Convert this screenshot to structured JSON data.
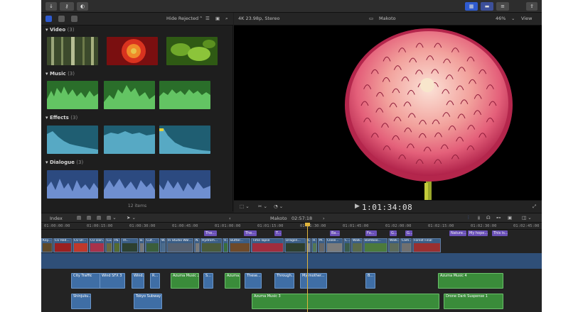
{
  "colors": {
    "accent": "#2f5bd0",
    "clip_video": "#3b5e86",
    "clip_audio_green": "#3a8c3a",
    "clip_title": "#6a50b8",
    "playhead": "#e0b43c"
  },
  "browser": {
    "filter_label": "Hide Rejected",
    "sections": [
      {
        "name": "Video",
        "count": "(3)"
      },
      {
        "name": "Music",
        "count": "(3)"
      },
      {
        "name": "Effects",
        "count": "(3)"
      },
      {
        "name": "Dialogue",
        "count": "(3)"
      }
    ],
    "items_count": "12 items"
  },
  "viewer": {
    "format": "4K 23.98p, Stereo",
    "project_name": "Makoto",
    "zoom": "46%",
    "view_label": "View",
    "timecode": "1:01:34:08"
  },
  "timeline": {
    "index_label": "Index",
    "project_name": "Makoto",
    "duration": "02:57:18",
    "ruler": [
      "01:00:00:00",
      "01:00:15:00",
      "01:00:30:00",
      "01:00:45:00",
      "01:01:00:00",
      "01:01:15:00",
      "01:01:30:00",
      "01:01:45:00",
      "01:02:00:00",
      "01:02:15:00",
      "01:02:30:00",
      "01:02:45:00"
    ],
    "titles": [
      "The...",
      "The...",
      "T...",
      "Ba...",
      "Fo...",
      "G...",
      "G...",
      "Nature...",
      "My hope...",
      "This is..."
    ],
    "video_clips": [
      "Kay...",
      "CU Red...",
      "CU Dr...",
      "CU Dan...",
      "Cu...",
      "Pa...",
      "Th...",
      "B...",
      "Cut...",
      "W...",
      "In Studio Wal...",
      "N...",
      "Hydrom...",
      "V...",
      "Butter...",
      "Time lapse",
      "Dragon...",
      "C",
      "H...",
      "M...",
      "Close...",
      "C...",
      "Walk...",
      "Bamboo...",
      "Walk...",
      "Cam...",
      "Forest Final"
    ],
    "connected_clips": [
      "City Traffic",
      "Wind SFX 3",
      "Wind...",
      "R...",
      "Azuma Music 2",
      "S...",
      "Azuma...",
      "These...",
      "Through...",
      "My mother...",
      "B...",
      "Azuma Music 4",
      "Shinjuku...",
      "Tokyo Subway",
      "Azuma Music 3",
      "Drone Dark Suspense 1"
    ]
  }
}
